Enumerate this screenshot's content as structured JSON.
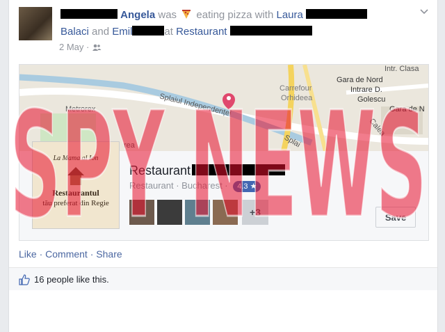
{
  "post": {
    "author": "Angela",
    "was": "was",
    "activity": "eating pizza",
    "with_word": "with",
    "friend1": "Laura",
    "friend2": "Balaci",
    "and_word": "and",
    "friend3": "Emil",
    "at_suffix": "at",
    "place_link": "Restaurant",
    "date": "2 May",
    "privacy_icon": "friends-icon"
  },
  "map": {
    "labels": [
      "Intr. Clasa",
      "Gara de Nord",
      "Intrare D.",
      "Golescu",
      "Gara de N",
      "Carrefour",
      "Orhideea",
      "Metrorex",
      "Splaiul Independenței",
      "Splai",
      "Calea",
      "rea"
    ]
  },
  "place": {
    "name": "Restaurant",
    "category": "Restaurant · Bucharest ·",
    "rating": "4.3 ★",
    "more_count": "+3",
    "save_label": "Save",
    "thumb_lines": [
      "La Mama al Ion",
      "Restaurantul",
      "tău preferat din Regie"
    ]
  },
  "actions": {
    "like": "Like",
    "comment": "Comment",
    "share": "Share",
    "dot": " · "
  },
  "likes": {
    "text": "16 people like this."
  },
  "watermark": {
    "text": "SPY NEWS"
  },
  "colors": {
    "link": "#365899",
    "watermark": "#e8112d"
  }
}
